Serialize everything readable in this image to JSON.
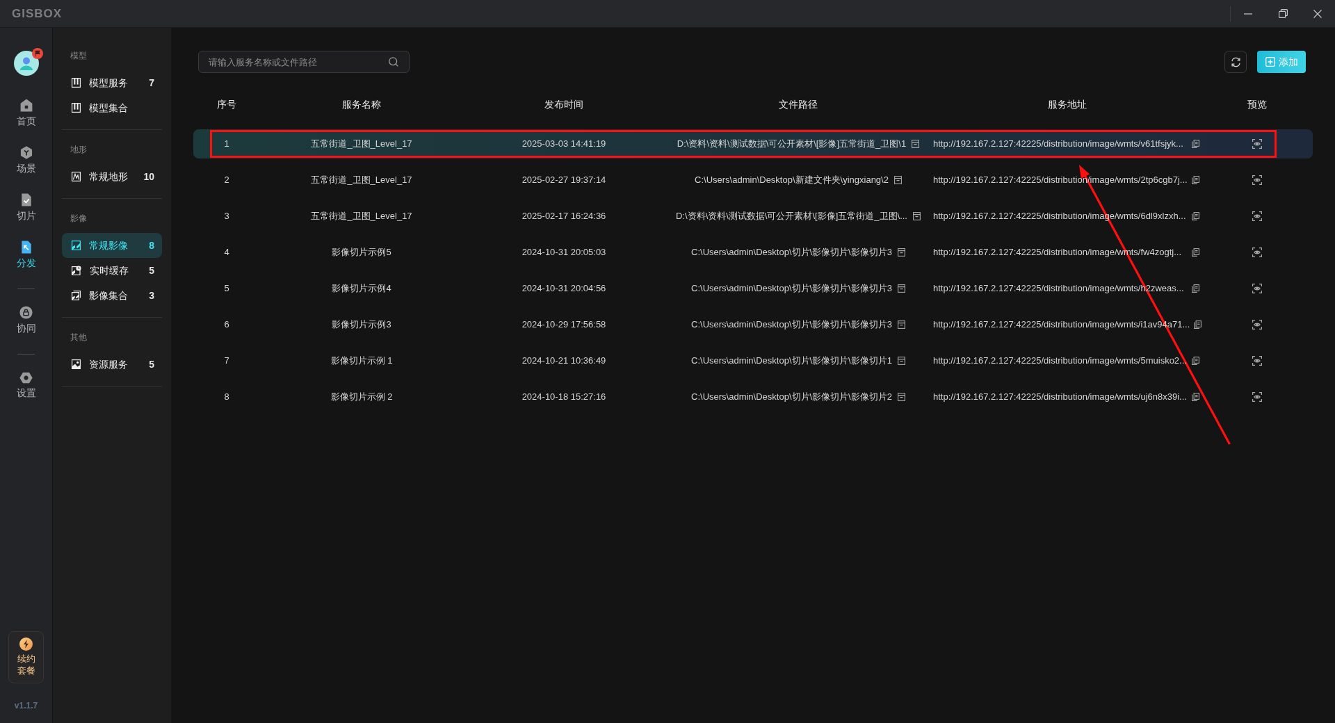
{
  "window": {
    "logo": "GISBOX"
  },
  "rail": {
    "avatar": {
      "badge": true
    },
    "items": [
      {
        "label": "首页",
        "selected": false,
        "divider_before": false
      },
      {
        "label": "场景",
        "selected": false,
        "divider_before": false
      },
      {
        "label": "切片",
        "selected": false,
        "divider_before": false
      },
      {
        "label": "分发",
        "selected": true,
        "divider_before": false
      },
      {
        "label": "协同",
        "selected": false,
        "divider_before": true
      },
      {
        "label": "设置",
        "selected": false,
        "divider_before": true
      }
    ],
    "promo": {
      "label": "续约套餐"
    },
    "version": "v1.1.7"
  },
  "nav": {
    "sections": [
      {
        "title": "模型",
        "items": [
          {
            "label": "模型服务",
            "count": "7",
            "selected": false
          },
          {
            "label": "模型集合",
            "selected": false
          }
        ]
      },
      {
        "title": "地形",
        "items": [
          {
            "label": "常规地形",
            "count": "10",
            "selected": false
          }
        ]
      },
      {
        "title": "影像",
        "items": [
          {
            "label": "常规影像",
            "count": "8",
            "selected": true
          },
          {
            "label": "实时缓存",
            "count": "5",
            "selected": false
          },
          {
            "label": "影像集合",
            "count": "3",
            "selected": false
          }
        ]
      },
      {
        "title": "其他",
        "items": [
          {
            "label": "资源服务",
            "count": "5",
            "selected": false
          }
        ]
      }
    ]
  },
  "toolbar": {
    "search": {
      "placeholder": "请输入服务名称或文件路径"
    },
    "add_button": {
      "label": "添加"
    }
  },
  "table": {
    "columns": [
      "序号",
      "服务名称",
      "发布时间",
      "文件路径",
      "服务地址",
      "预览"
    ],
    "rows": [
      {
        "index": "1",
        "name": "五常街道_卫图_Level_17",
        "time": "2025-03-03 14:41:19",
        "path": "D:\\资料\\资料\\测试数据\\可公开素材\\[影像]五常街道_卫图\\1",
        "url": "http://192.167.2.127:42225/distribution/image/wmts/v61tfsjyk...",
        "selected": true,
        "marked": true
      },
      {
        "index": "2",
        "name": "五常街道_卫图_Level_17",
        "time": "2025-02-27 19:37:14",
        "path": "C:\\Users\\admin\\Desktop\\新建文件夹\\yingxiang\\2",
        "url": "http://192.167.2.127:42225/distribution/image/wmts/2tp6cgb7j...",
        "selected": false,
        "marked": false
      },
      {
        "index": "3",
        "name": "五常街道_卫图_Level_17",
        "time": "2025-02-17 16:24:36",
        "path": "D:\\资料\\资料\\测试数据\\可公开素材\\[影像]五常街道_卫图\\...",
        "url": "http://192.167.2.127:42225/distribution/image/wmts/6dl9xlzxh...",
        "selected": false,
        "marked": false
      },
      {
        "index": "4",
        "name": "影像切片示例5",
        "time": "2024-10-31 20:05:03",
        "path": "C:\\Users\\admin\\Desktop\\切片\\影像切片\\影像切片3",
        "url": "http://192.167.2.127:42225/distribution/image/wmts/fw4zogtj...",
        "selected": false,
        "marked": false
      },
      {
        "index": "5",
        "name": "影像切片示例4",
        "time": "2024-10-31 20:04:56",
        "path": "C:\\Users\\admin\\Desktop\\切片\\影像切片\\影像切片3",
        "url": "http://192.167.2.127:42225/distribution/image/wmts/h2zweas...",
        "selected": false,
        "marked": false
      },
      {
        "index": "6",
        "name": "影像切片示例3",
        "time": "2024-10-29 17:56:58",
        "path": "C:\\Users\\admin\\Desktop\\切片\\影像切片\\影像切片3",
        "url": "http://192.167.2.127:42225/distribution/image/wmts/i1av94a71...",
        "selected": false,
        "marked": false
      },
      {
        "index": "7",
        "name": "影像切片示例 1",
        "time": "2024-10-21 10:36:49",
        "path": "C:\\Users\\admin\\Desktop\\切片\\影像切片\\影像切片1",
        "url": "http://192.167.2.127:42225/distribution/image/wmts/5muisko2...",
        "selected": false,
        "marked": false
      },
      {
        "index": "8",
        "name": "影像切片示例 2",
        "time": "2024-10-18 15:27:16",
        "path": "C:\\Users\\admin\\Desktop\\切片\\影像切片\\影像切片2",
        "url": "http://192.167.2.127:42225/distribution/image/wmts/uj6n8x39i...",
        "selected": false,
        "marked": false
      }
    ]
  }
}
